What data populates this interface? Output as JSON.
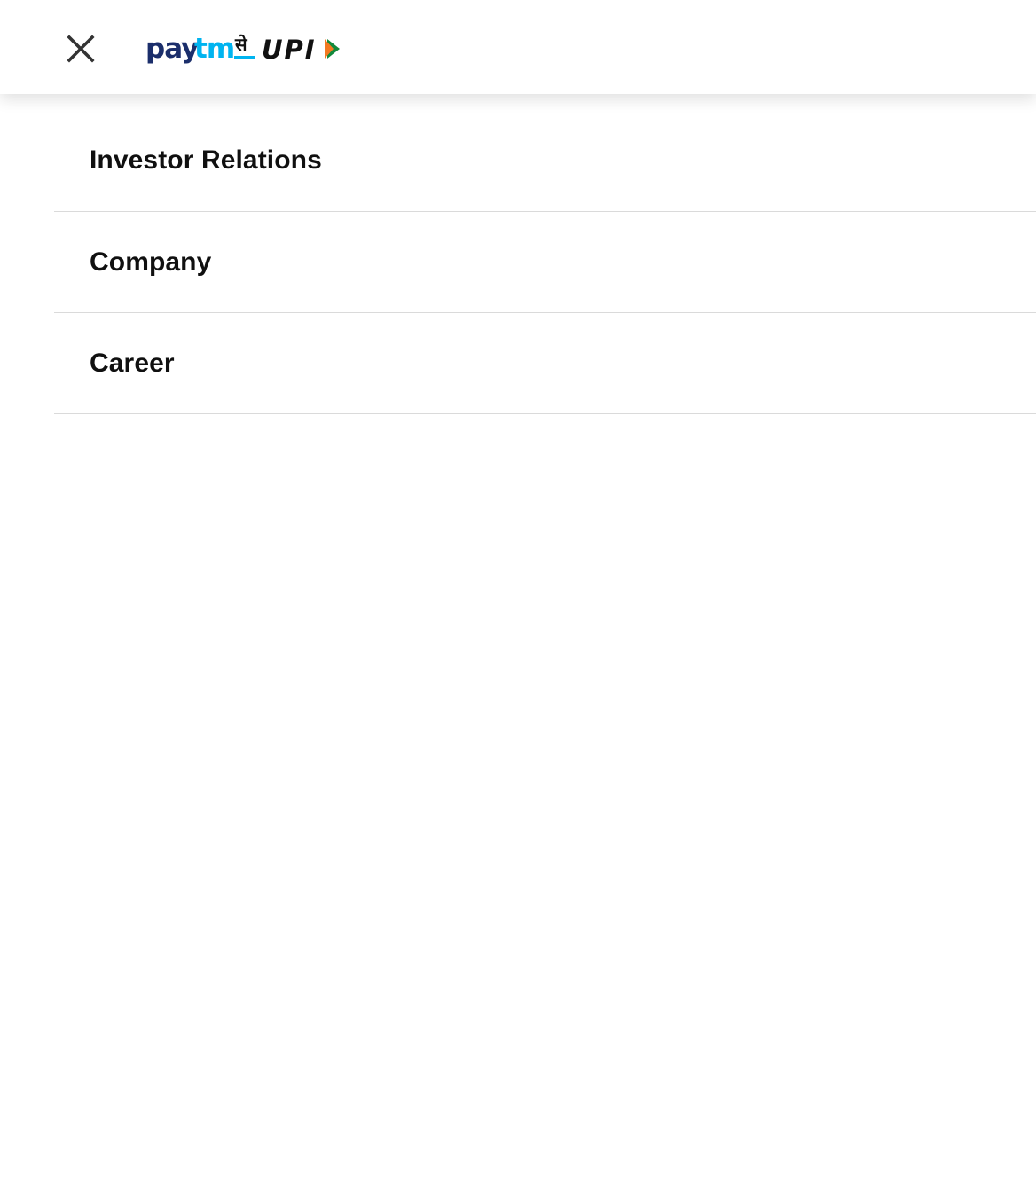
{
  "header": {
    "close_icon": "close-icon",
    "logo": {
      "brand": "Paytm",
      "brand_part1": "pay",
      "brand_part2": "tm",
      "hindi_word": "से",
      "upi": "UPI",
      "colors": {
        "pay": "#1b2e6b",
        "tm": "#00b4f0",
        "upi": "#111111",
        "upi_arrow_orange": "#f47920",
        "upi_arrow_green": "#138a3c"
      }
    }
  },
  "menu": {
    "items": [
      {
        "label": "Investor Relations"
      },
      {
        "label": "Company"
      },
      {
        "label": "Career"
      }
    ]
  }
}
